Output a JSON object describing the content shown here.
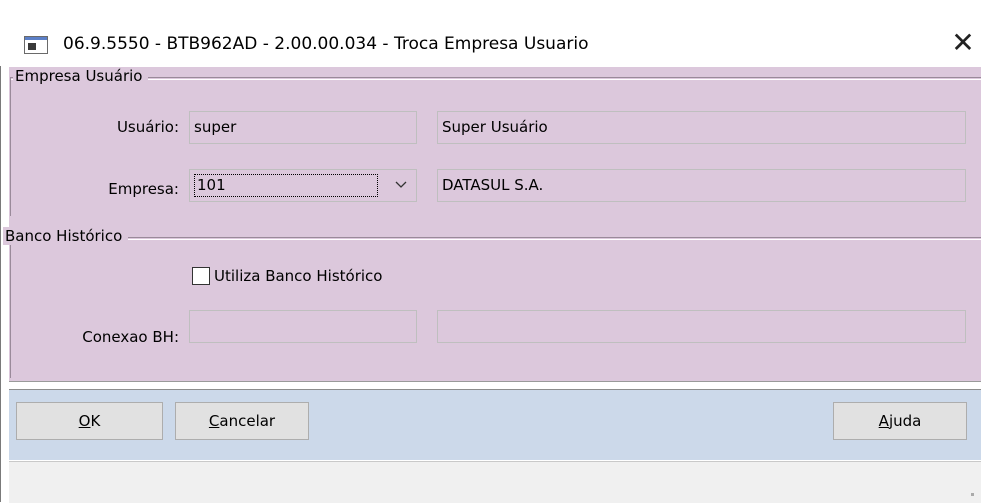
{
  "window": {
    "title": "06.9.5550 - BTB962AD - 2.00.00.034 - Troca Empresa Usuario",
    "close_glyph": "✕",
    "title_icon": "window-app-icon"
  },
  "empresa_usuario": {
    "legend": "Empresa Usuário",
    "usuario_label": "Usuário:",
    "usuario_code": "super",
    "usuario_name": "Super Usuário",
    "empresa_label": "Empresa:",
    "empresa_code": "101",
    "empresa_name": "DATASUL S.A."
  },
  "banco_historico": {
    "legend": "Banco Histórico",
    "checkbox_label": "Utiliza Banco Histórico",
    "checkbox_checked": false,
    "conexao_label": "Conexao BH:",
    "conexao_value": "",
    "conexao_desc": ""
  },
  "buttons": {
    "ok_mnemonic": "O",
    "ok_rest": "K",
    "cancel_mnemonic": "C",
    "cancel_rest": "ancelar",
    "help_mnemonic": "A",
    "help_rest": "juda"
  },
  "colors": {
    "client_bg": "#dcc8dc",
    "button_bar_bg": "#ccd9ea"
  }
}
